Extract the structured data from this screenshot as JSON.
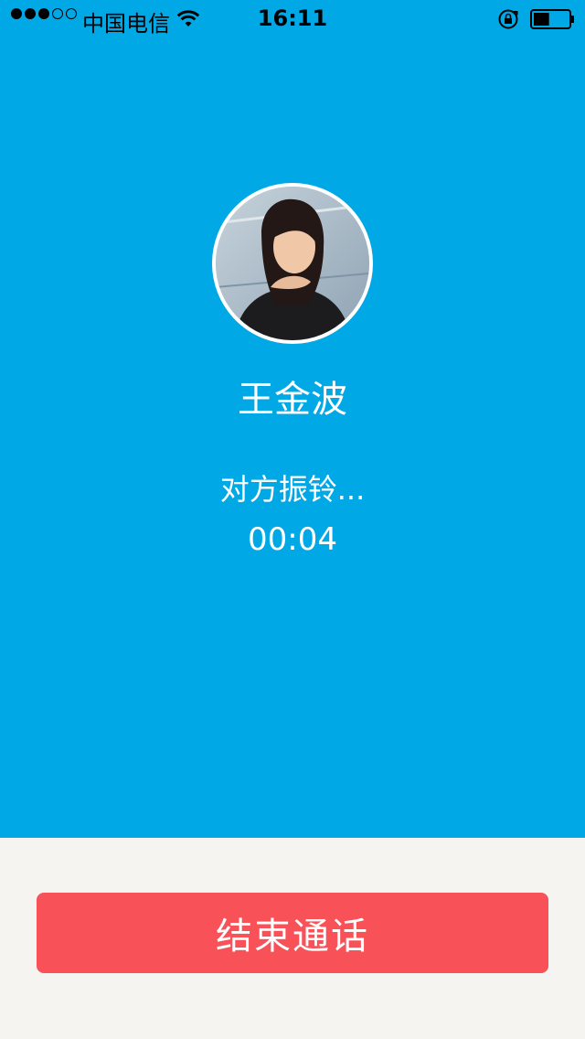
{
  "status_bar": {
    "signal_filled": 3,
    "signal_total": 5,
    "carrier": "中国电信",
    "time": "16:11",
    "battery_level": 0.45
  },
  "caller": {
    "name": "王金波",
    "status": "对方振铃...",
    "timer": "00:04"
  },
  "actions": {
    "end_call_label": "结束通话"
  },
  "colors": {
    "call_background": "#00a8e6",
    "bottom_background": "#f5f4f0",
    "end_call_button": "#f95158"
  },
  "icons": {
    "wifi": "wifi-icon",
    "orientation_lock": "orientation-lock-icon",
    "battery": "battery-icon",
    "avatar": "avatar-photo"
  }
}
